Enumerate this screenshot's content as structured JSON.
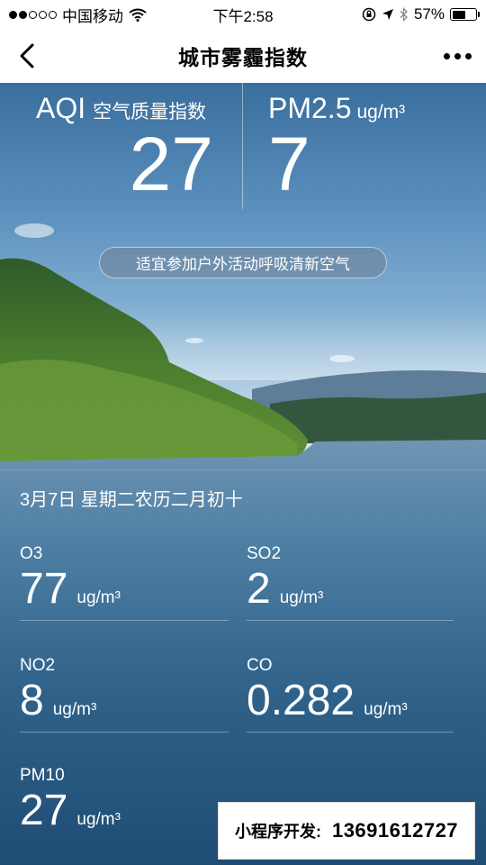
{
  "status_bar": {
    "carrier": "中国移动",
    "signal_strength": 2,
    "time": "下午2:58",
    "battery_percent": "57%",
    "battery_level": 0.57
  },
  "nav": {
    "title": "城市雾霾指数"
  },
  "aqi": {
    "label": "AQI",
    "sub_label": "空气质量指数",
    "value": "27"
  },
  "pm25": {
    "label": "PM2.5",
    "unit": "ug/m³",
    "value": "7"
  },
  "advice": "适宜参加户外活动呼吸清新空气",
  "date_line": "3月7日  星期二农历二月初十",
  "pollutants": [
    {
      "name": "O3",
      "value": "77",
      "unit": "ug/m³"
    },
    {
      "name": "SO2",
      "value": "2",
      "unit": "ug/m³"
    },
    {
      "name": "NO2",
      "value": "8",
      "unit": "ug/m³"
    },
    {
      "name": "CO",
      "value": "0.282",
      "unit": "ug/m³"
    },
    {
      "name": "PM10",
      "value": "27",
      "unit": "ug/m³"
    }
  ],
  "watermark": {
    "label": "小程序开发:",
    "phone": "13691612727"
  },
  "icons": {
    "wifi": "wifi-icon",
    "lock_rotation": "rotation-lock-icon",
    "location": "location-arrow-icon",
    "bluetooth": "bluetooth-icon",
    "battery": "battery-icon",
    "back": "chevron-left-icon",
    "more": "more-dots-icon"
  }
}
